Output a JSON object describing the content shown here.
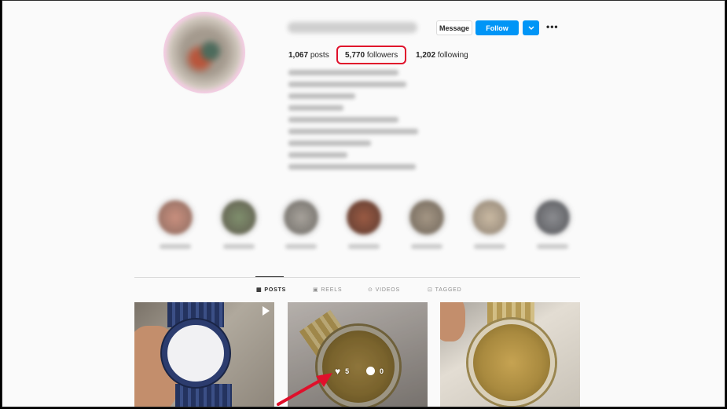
{
  "profile": {
    "message_label": "Message",
    "follow_label": "Follow",
    "suggest_icon": "chevron-down-icon",
    "more_label": "•••",
    "posts_count": "1,067",
    "posts_label": "posts",
    "followers_count": "5,770",
    "followers_label": "followers",
    "following_count": "1,202",
    "following_label": "following"
  },
  "tabs": [
    {
      "label": "POSTS",
      "icon": "▦",
      "active": true
    },
    {
      "label": "REELS",
      "icon": "▣",
      "active": false
    },
    {
      "label": "VIDEOS",
      "icon": "⊙",
      "active": false
    },
    {
      "label": "TAGGED",
      "icon": "⊡",
      "active": false
    }
  ],
  "post_overlay": {
    "likes": "5",
    "comments": "0"
  },
  "colors": {
    "accent": "#0095f6",
    "annotation": "#e0102b"
  }
}
